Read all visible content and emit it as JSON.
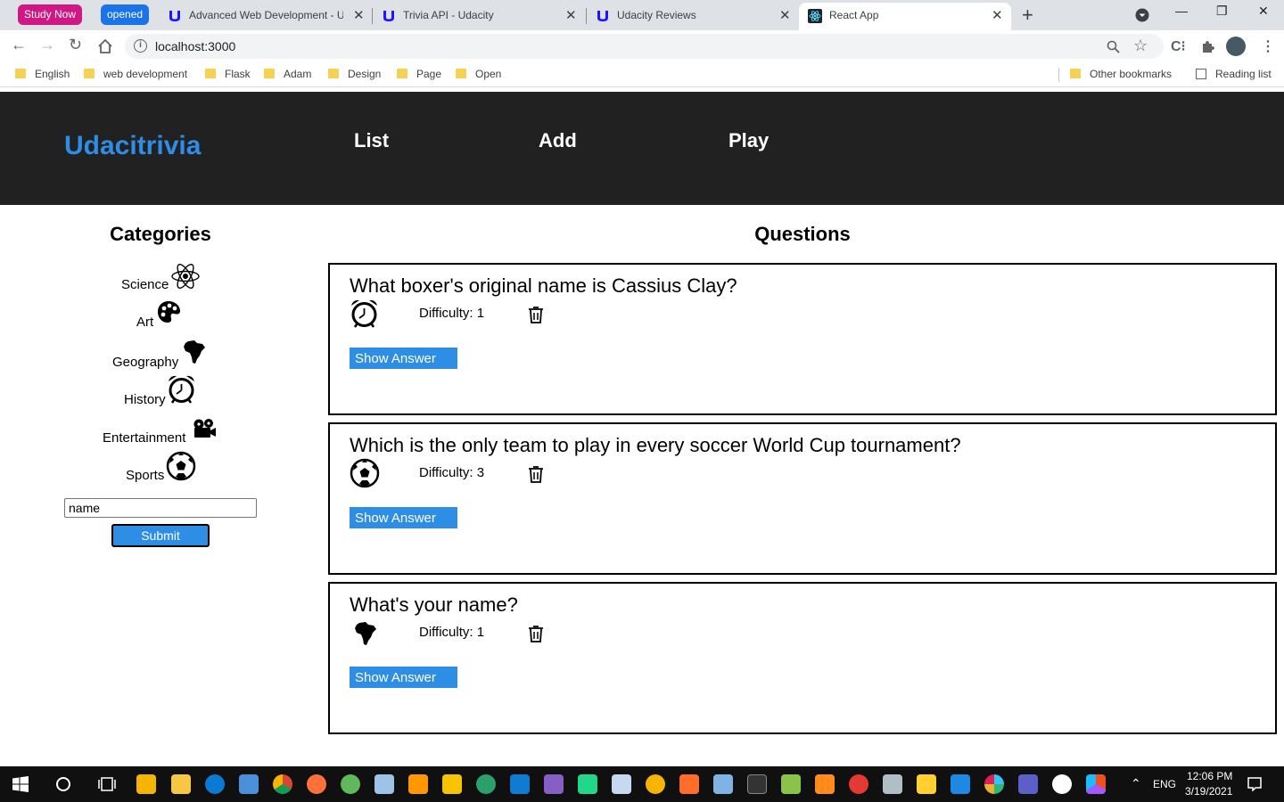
{
  "browser": {
    "tab_groups": [
      {
        "label": "Study Now",
        "color": "#d01884"
      },
      {
        "label": "opened",
        "color": "#1a73e8"
      }
    ],
    "tabs": [
      {
        "title": "Advanced Web Development - Udacity",
        "active": false
      },
      {
        "title": "Trivia API - Udacity",
        "active": false
      },
      {
        "title": "Udacity Reviews",
        "active": false
      },
      {
        "title": "React App",
        "active": true
      }
    ],
    "url": "localhost:3000",
    "bookmarks": [
      "English",
      "web development",
      "Flask",
      "Adam",
      "Design",
      "Page",
      "Open"
    ],
    "other_bookmarks": "Other bookmarks",
    "reading_list": "Reading list"
  },
  "app": {
    "brand": "Udacitrivia",
    "nav": [
      "List",
      "Add",
      "Play"
    ],
    "accent_color": "#2e8de5",
    "header_color": "#212121"
  },
  "categories": {
    "title": "Categories",
    "items": [
      {
        "label": "Science",
        "icon": "atom-icon"
      },
      {
        "label": "Art",
        "icon": "palette-icon"
      },
      {
        "label": "Geography",
        "icon": "africa-map-icon"
      },
      {
        "label": "History",
        "icon": "alarm-clock-icon"
      },
      {
        "label": "Entertainment",
        "icon": "film-camera-icon"
      },
      {
        "label": "Sports",
        "icon": "soccer-ball-icon"
      }
    ],
    "search_value": "name",
    "submit_label": "Submit"
  },
  "questions": {
    "title": "Questions",
    "items": [
      {
        "question": "What boxer's original name is Cassius Clay?",
        "category_icon": "alarm-clock-icon",
        "difficulty_label": "Difficulty: 1",
        "button": "Show Answer"
      },
      {
        "question": "Which is the only team to play in every soccer World Cup tournament?",
        "category_icon": "soccer-ball-icon",
        "difficulty_label": "Difficulty: 3",
        "button": "Show Answer"
      },
      {
        "question": "What's your name?",
        "category_icon": "africa-map-icon",
        "difficulty_label": "Difficulty: 1",
        "button": "Show Answer"
      }
    ]
  },
  "taskbar": {
    "language": "ENG",
    "time": "12:06 PM",
    "date": "3/19/2021"
  }
}
